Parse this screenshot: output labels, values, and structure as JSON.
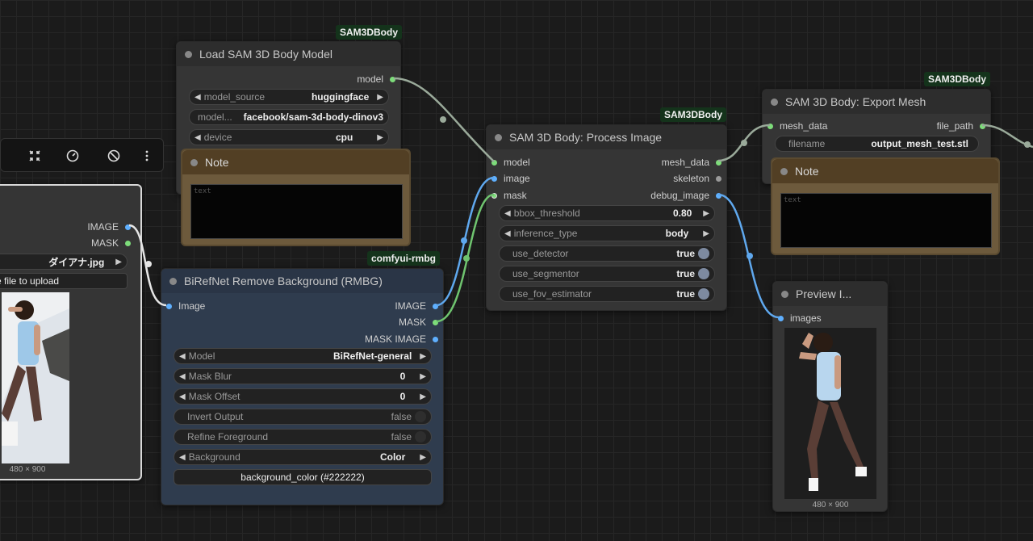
{
  "colors": {
    "canvas_bg": "#1b1b1b",
    "node_bg": "#353535",
    "node_title_bg": "#2d2d2d",
    "birefnet_bg": "#2f3c4e",
    "note_bg": "#6d5a3c",
    "badge_bg": "#14331b",
    "slot_green": "#7ddc7a",
    "slot_blue": "#5fb0ff",
    "slot_gray": "#9a9a9a",
    "link_gray": "#9aaa9a",
    "link_blue": "#5fa8ee",
    "link_green": "#6fc46f",
    "link_white": "#e6e6e6"
  },
  "toolbar": {
    "icons": [
      "collapse-icon",
      "dial-icon",
      "bypass-icon",
      "more-vertical-icon"
    ]
  },
  "load_image_node": {
    "outputs": [
      "IMAGE",
      "MASK"
    ],
    "image_value": "ダイアナ.jpg",
    "upload_label": "se file to upload",
    "image_caption": "480 × 900"
  },
  "load_model_node": {
    "badge": "SAM3DBody",
    "title": "Load SAM 3D Body Model",
    "output": "model",
    "widgets": [
      {
        "label": "model_source",
        "value": "huggingface"
      },
      {
        "label": "model...",
        "value": "facebook/sam-3d-body-dinov3"
      },
      {
        "label": "device",
        "value": "cpu"
      }
    ]
  },
  "note1": {
    "title": "Note",
    "placeholder": "text"
  },
  "birefnet_node": {
    "badge": "comfyui-rmbg",
    "title": "BiRefNet Remove Background (RMBG)",
    "input": "Image",
    "outputs": [
      "IMAGE",
      "MASK",
      "MASK IMAGE"
    ],
    "widgets": [
      {
        "label": "Model",
        "value": "BiRefNet-general"
      },
      {
        "label": "Mask Blur",
        "value": "0"
      },
      {
        "label": "Mask Offset",
        "value": "0"
      },
      {
        "label": "Invert Output",
        "value": "false"
      },
      {
        "label": "Refine Foreground",
        "value": "false"
      },
      {
        "label": "Background",
        "value": "Color"
      }
    ],
    "button_label": "background_color (#222222)"
  },
  "process_node": {
    "badge": "SAM3DBody",
    "title": "SAM 3D Body: Process Image",
    "inputs": [
      "model",
      "image",
      "mask"
    ],
    "outputs": [
      "mesh_data",
      "skeleton",
      "debug_image"
    ],
    "widgets": [
      {
        "label": "bbox_threshold",
        "value": "0.80"
      },
      {
        "label": "inference_type",
        "value": "body"
      },
      {
        "label": "use_detector",
        "value": "true"
      },
      {
        "label": "use_segmentor",
        "value": "true"
      },
      {
        "label": "use_fov_estimator",
        "value": "true"
      }
    ]
  },
  "export_node": {
    "badge": "SAM3DBody",
    "title": "SAM 3D Body: Export Mesh",
    "input": "mesh_data",
    "output": "file_path",
    "widget": {
      "label": "filename",
      "value": "output_mesh_test.stl"
    }
  },
  "note2": {
    "title": "Note",
    "placeholder": "text"
  },
  "preview_node": {
    "title": "Preview I...",
    "input": "images",
    "image_caption": "480 × 900"
  }
}
